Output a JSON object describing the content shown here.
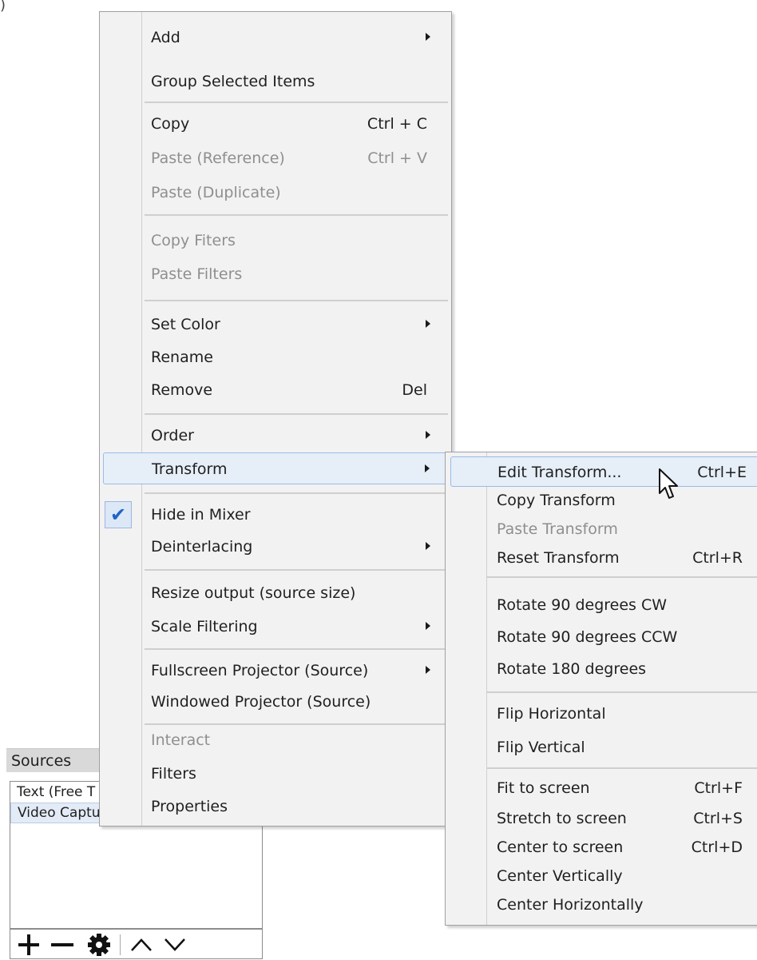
{
  "corner_fragment": ")",
  "sources": {
    "header": "Sources",
    "items": [
      {
        "label": "Text (Free T",
        "selected": false
      },
      {
        "label": "Video Capture Device",
        "selected": true
      }
    ]
  },
  "main_menu": {
    "items": [
      {
        "label": "Add",
        "shortcut": "",
        "submenu": true,
        "disabled": false
      },
      {
        "label": "Group Selected Items",
        "shortcut": "",
        "submenu": false,
        "disabled": false
      },
      {
        "label": "Copy",
        "shortcut": "Ctrl + C",
        "submenu": false,
        "disabled": false
      },
      {
        "label": "Paste (Reference)",
        "shortcut": "Ctrl + V",
        "submenu": false,
        "disabled": true
      },
      {
        "label": "Paste (Duplicate)",
        "shortcut": "",
        "submenu": false,
        "disabled": true
      },
      {
        "label": "Copy Fiters",
        "shortcut": "",
        "submenu": false,
        "disabled": true
      },
      {
        "label": "Paste Filters",
        "shortcut": "",
        "submenu": false,
        "disabled": true
      },
      {
        "label": "Set Color",
        "shortcut": "",
        "submenu": true,
        "disabled": false
      },
      {
        "label": "Rename",
        "shortcut": "",
        "submenu": false,
        "disabled": false
      },
      {
        "label": "Remove",
        "shortcut": "Del",
        "submenu": false,
        "disabled": false
      },
      {
        "label": "Order",
        "shortcut": "",
        "submenu": true,
        "disabled": false
      },
      {
        "label": "Transform",
        "shortcut": "",
        "submenu": true,
        "disabled": false,
        "highlighted": true
      },
      {
        "label": "Hide in Mixer",
        "shortcut": "",
        "submenu": false,
        "disabled": false,
        "checked": true
      },
      {
        "label": "Deinterlacing",
        "shortcut": "",
        "submenu": true,
        "disabled": false
      },
      {
        "label": "Resize output (source size)",
        "shortcut": "",
        "submenu": false,
        "disabled": false
      },
      {
        "label": "Scale Filtering",
        "shortcut": "",
        "submenu": true,
        "disabled": false
      },
      {
        "label": "Fullscreen Projector (Source)",
        "shortcut": "",
        "submenu": true,
        "disabled": false
      },
      {
        "label": "Windowed Projector (Source)",
        "shortcut": "",
        "submenu": false,
        "disabled": false
      },
      {
        "label": "Interact",
        "shortcut": "",
        "submenu": false,
        "disabled": true
      },
      {
        "label": "Filters",
        "shortcut": "",
        "submenu": false,
        "disabled": false
      },
      {
        "label": "Properties",
        "shortcut": "",
        "submenu": false,
        "disabled": false
      }
    ]
  },
  "transform_menu": {
    "items": [
      {
        "label": "Edit Transform...",
        "shortcut": "Ctrl+E",
        "disabled": false,
        "highlighted": true
      },
      {
        "label": "Copy Transform",
        "shortcut": "",
        "disabled": false
      },
      {
        "label": "Paste Transform",
        "shortcut": "",
        "disabled": true
      },
      {
        "label": "Reset Transform",
        "shortcut": "Ctrl+R",
        "disabled": false
      },
      {
        "label": "Rotate 90 degrees CW",
        "shortcut": "",
        "disabled": false
      },
      {
        "label": "Rotate 90 degrees CCW",
        "shortcut": "",
        "disabled": false
      },
      {
        "label": "Rotate 180 degrees",
        "shortcut": "",
        "disabled": false
      },
      {
        "label": "Flip Horizontal",
        "shortcut": "",
        "disabled": false
      },
      {
        "label": "Flip Vertical",
        "shortcut": "",
        "disabled": false
      },
      {
        "label": "Fit to screen",
        "shortcut": "Ctrl+F",
        "disabled": false
      },
      {
        "label": "Stretch to screen",
        "shortcut": "Ctrl+S",
        "disabled": false
      },
      {
        "label": "Center to screen",
        "shortcut": "Ctrl+D",
        "disabled": false
      },
      {
        "label": "Center Vertically",
        "shortcut": "",
        "disabled": false
      },
      {
        "label": "Center Horizontally",
        "shortcut": "",
        "disabled": false
      }
    ]
  },
  "colors": {
    "menu_bg": "#f2f2f2",
    "highlight_bg": "#e6eef8",
    "highlight_border": "#99bbe6",
    "check_color": "#1f63c6",
    "disabled_text": "#8f8f8f"
  },
  "icons": {
    "submenu_arrow": "triangle-right-icon",
    "check": "checkmark-icon",
    "toolbar": [
      "plus-icon",
      "minus-icon",
      "gear-icon",
      "chevron-up-icon",
      "chevron-down-icon"
    ],
    "visibility": "eye-icon",
    "lock": "lock-icon",
    "cursor": "mouse-pointer-icon"
  }
}
